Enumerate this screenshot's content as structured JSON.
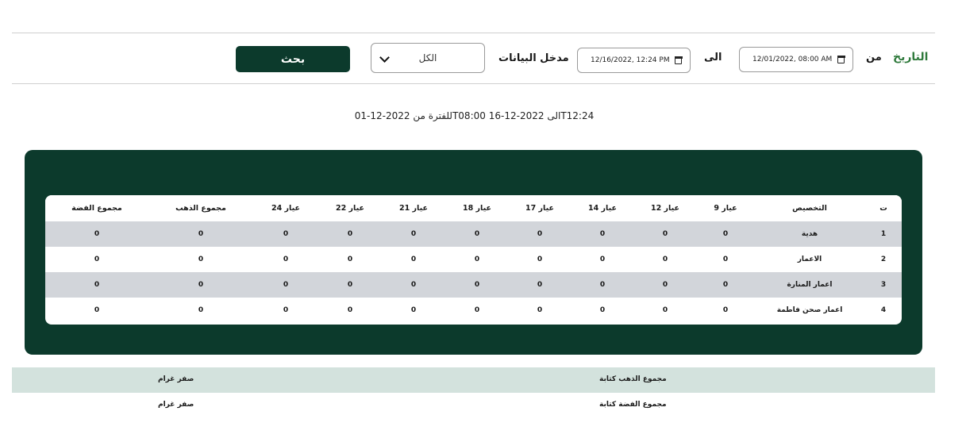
{
  "filters": {
    "date_label": "التاريخ",
    "from_label": "من",
    "from_value": "12/01/2022, 08:00 AM",
    "to_label": "الى",
    "to_value": "12/16/2022, 12:24 PM",
    "entry_label": "مدخل البيانات",
    "entry_selected": "الكل",
    "search_label": "بحث"
  },
  "period_text": "للفترة من 2022-12-01T08:00 الى 2022-12-16T12:24",
  "table": {
    "headers": [
      "ت",
      "التخصيص",
      "عيار 9",
      "عيار 12",
      "عيار 14",
      "عيار 17",
      "عيار 18",
      "عيار 21",
      "عيار 22",
      "عيار 24",
      "مجموع الذهب",
      "مجموع الفضة"
    ],
    "rows": [
      [
        "1",
        "هدية",
        "0",
        "0",
        "0",
        "0",
        "0",
        "0",
        "0",
        "0",
        "0",
        "0"
      ],
      [
        "2",
        "الاعمار",
        "0",
        "0",
        "0",
        "0",
        "0",
        "0",
        "0",
        "0",
        "0",
        "0"
      ],
      [
        "3",
        "اعمار المنارة",
        "0",
        "0",
        "0",
        "0",
        "0",
        "0",
        "0",
        "0",
        "0",
        "0"
      ],
      [
        "4",
        "اعمار صحن فاطمة",
        "0",
        "0",
        "0",
        "0",
        "0",
        "0",
        "0",
        "0",
        "0",
        "0"
      ]
    ]
  },
  "summary": {
    "gold_label": "مجموع الذهب كتابة",
    "gold_value": "صفر غرام",
    "silver_label": "مجموع الفضة كتابة",
    "silver_value": "صفر غرام"
  },
  "colors": {
    "primary": "#0c3a2c",
    "date_label": "#2f7a3c",
    "row_alt": "#d2d5da",
    "summary_alt": "#d3e2dd"
  }
}
